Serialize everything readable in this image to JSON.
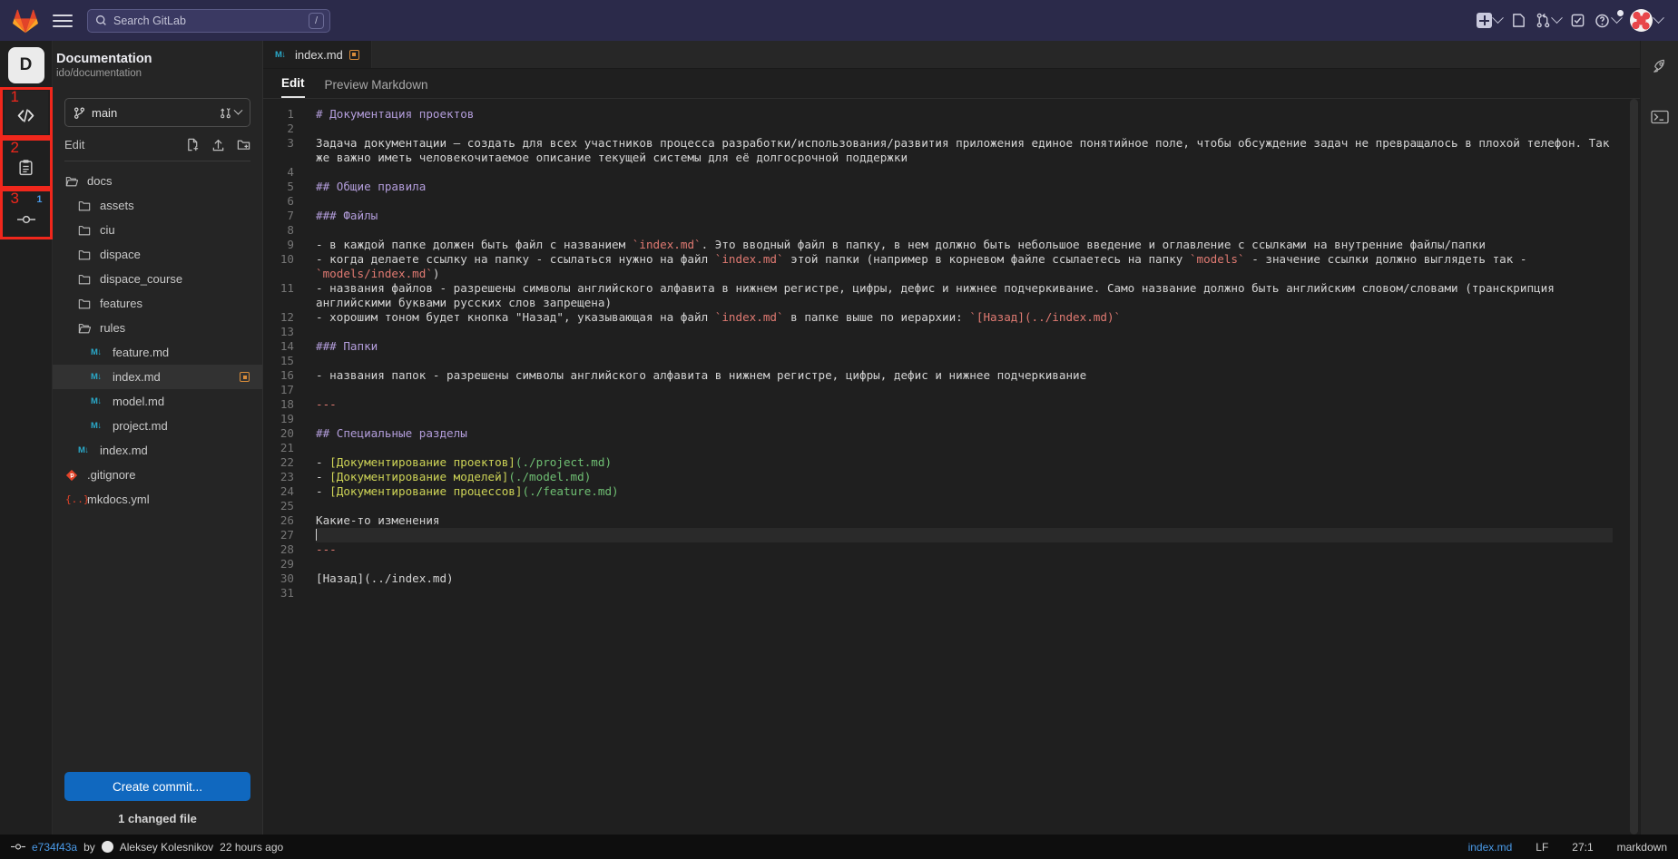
{
  "topnav": {
    "search_placeholder": "Search GitLab",
    "search_shortcut": "/",
    "icons": [
      "gitlab-logo",
      "hamburger-menu",
      "search-icon",
      "create-new-icon",
      "issues-icon",
      "merge-requests-icon",
      "todos-icon",
      "help-icon",
      "user-avatar"
    ]
  },
  "project": {
    "initial": "D",
    "name": "Documentation",
    "path": "ido/documentation"
  },
  "rail": {
    "items": [
      {
        "number": "1",
        "name": "edit-icon",
        "badge": ""
      },
      {
        "number": "2",
        "name": "review-icon",
        "badge": ""
      },
      {
        "number": "3",
        "name": "commit-icon",
        "badge": "1"
      }
    ]
  },
  "filepanel": {
    "branch": "main",
    "edit_label": "Edit",
    "actions": [
      "new-file-icon",
      "upload-file-icon",
      "new-directory-icon"
    ],
    "tree": [
      {
        "label": "docs",
        "type": "folder-open",
        "depth": 0,
        "modified": false,
        "selected": false
      },
      {
        "label": "assets",
        "type": "folder",
        "depth": 1,
        "modified": false,
        "selected": false
      },
      {
        "label": "ciu",
        "type": "folder",
        "depth": 1,
        "modified": false,
        "selected": false
      },
      {
        "label": "dispace",
        "type": "folder",
        "depth": 1,
        "modified": false,
        "selected": false
      },
      {
        "label": "dispace_course",
        "type": "folder",
        "depth": 1,
        "modified": false,
        "selected": false
      },
      {
        "label": "features",
        "type": "folder",
        "depth": 1,
        "modified": false,
        "selected": false
      },
      {
        "label": "rules",
        "type": "folder-open",
        "depth": 1,
        "modified": false,
        "selected": false
      },
      {
        "label": "feature.md",
        "type": "markdown",
        "depth": 2,
        "modified": false,
        "selected": false
      },
      {
        "label": "index.md",
        "type": "markdown",
        "depth": 2,
        "modified": true,
        "selected": true
      },
      {
        "label": "model.md",
        "type": "markdown",
        "depth": 2,
        "modified": false,
        "selected": false
      },
      {
        "label": "project.md",
        "type": "markdown",
        "depth": 2,
        "modified": false,
        "selected": false
      },
      {
        "label": "index.md",
        "type": "markdown",
        "depth": 1,
        "modified": false,
        "selected": false
      },
      {
        "label": ".gitignore",
        "type": "git",
        "depth": 0,
        "modified": false,
        "selected": false
      },
      {
        "label": "mkdocs.yml",
        "type": "yaml",
        "depth": 0,
        "modified": false,
        "selected": false
      }
    ],
    "commit_button": "Create commit...",
    "changed_files": "1 changed file"
  },
  "editor": {
    "tab": {
      "label": "index.md",
      "modified": true
    },
    "subtabs": [
      {
        "label": "Edit",
        "active": true
      },
      {
        "label": "Preview Markdown",
        "active": false
      }
    ],
    "lines": [
      {
        "n": 1,
        "parts": [
          {
            "t": "# Документация проектов",
            "c": "h"
          }
        ]
      },
      {
        "n": 2,
        "parts": []
      },
      {
        "n": 3,
        "parts": [
          {
            "t": "Задача документации — создать для всех участников процесса разработки/использования/развития приложения единое понятийное поле, чтобы обсуждение задач не превращалось в плохой телефон. Так же важно иметь человекочитаемое описание текущей системы для её долгосрочной поддержки",
            "c": ""
          }
        ]
      },
      {
        "n": 4,
        "parts": []
      },
      {
        "n": 5,
        "parts": [
          {
            "t": "## Общие правила",
            "c": "h"
          }
        ]
      },
      {
        "n": 6,
        "parts": []
      },
      {
        "n": 7,
        "parts": [
          {
            "t": "### Файлы",
            "c": "h"
          }
        ]
      },
      {
        "n": 8,
        "parts": []
      },
      {
        "n": 9,
        "parts": [
          {
            "t": "- в каждой папке должен быть файл с названием ",
            "c": ""
          },
          {
            "t": "`index.md`",
            "c": "c"
          },
          {
            "t": ". Это вводный файл в папку, в нем должно быть небольшое введение и оглавление с ссылками на внутренние файлы/папки",
            "c": ""
          }
        ]
      },
      {
        "n": 10,
        "parts": [
          {
            "t": "- когда делаете ссылку на папку - ссылаться нужно на файл ",
            "c": ""
          },
          {
            "t": "`index.md`",
            "c": "c"
          },
          {
            "t": " этой папки (например в корневом файле ссылаетесь на папку ",
            "c": ""
          },
          {
            "t": "`models`",
            "c": "c"
          },
          {
            "t": " - значение ссылки должно выглядеть так - ",
            "c": ""
          },
          {
            "t": "`models/index.md`",
            "c": "c"
          },
          {
            "t": ")",
            "c": ""
          }
        ]
      },
      {
        "n": 11,
        "parts": [
          {
            "t": "- названия файлов - разрешены символы английского алфавита в нижнем регистре, цифры, дефис и нижнее подчеркивание. Само название должно быть английским словом/словами (транскрипция английскими буквами русских слов запрещена)",
            "c": ""
          }
        ]
      },
      {
        "n": 12,
        "parts": [
          {
            "t": "- хорошим тоном будет кнопка \"Назад\", указывающая на файл ",
            "c": ""
          },
          {
            "t": "`index.md`",
            "c": "c"
          },
          {
            "t": " в папке выше по иерархии: ",
            "c": ""
          },
          {
            "t": "`[Назад](../index.md)`",
            "c": "c"
          }
        ]
      },
      {
        "n": 13,
        "parts": []
      },
      {
        "n": 14,
        "parts": [
          {
            "t": "### Папки",
            "c": "h"
          }
        ]
      },
      {
        "n": 15,
        "parts": []
      },
      {
        "n": 16,
        "parts": [
          {
            "t": "- названия папок - разрешены символы английского алфавита в нижнем регистре, цифры, дефис и нижнее подчеркивание",
            "c": ""
          }
        ]
      },
      {
        "n": 17,
        "parts": []
      },
      {
        "n": 18,
        "parts": [
          {
            "t": "---",
            "c": "hr"
          }
        ]
      },
      {
        "n": 19,
        "parts": []
      },
      {
        "n": 20,
        "parts": [
          {
            "t": "## Специальные разделы",
            "c": "h"
          }
        ]
      },
      {
        "n": 21,
        "parts": []
      },
      {
        "n": 22,
        "parts": [
          {
            "t": "- ",
            "c": ""
          },
          {
            "t": "[Документирование проектов]",
            "c": "lk"
          },
          {
            "t": "(./project.md)",
            "c": "ur"
          }
        ]
      },
      {
        "n": 23,
        "parts": [
          {
            "t": "- ",
            "c": ""
          },
          {
            "t": "[Документирование моделей]",
            "c": "lk"
          },
          {
            "t": "(./model.md)",
            "c": "ur"
          }
        ]
      },
      {
        "n": 24,
        "parts": [
          {
            "t": "- ",
            "c": ""
          },
          {
            "t": "[Документирование процессов]",
            "c": "lk"
          },
          {
            "t": "(./feature.md)",
            "c": "ur"
          }
        ]
      },
      {
        "n": 25,
        "parts": []
      },
      {
        "n": 26,
        "parts": [
          {
            "t": "Какие-то изменения",
            "c": ""
          }
        ]
      },
      {
        "n": 27,
        "parts": [],
        "cursor": true
      },
      {
        "n": 28,
        "parts": [
          {
            "t": "---",
            "c": "hr"
          }
        ]
      },
      {
        "n": 29,
        "parts": []
      },
      {
        "n": 30,
        "parts": [
          {
            "t": "[Назад](../index.md)",
            "c": ""
          }
        ]
      },
      {
        "n": 31,
        "parts": []
      }
    ]
  },
  "rightrail": {
    "items": [
      "rocket-icon",
      "terminal-icon"
    ]
  },
  "statusbar": {
    "sha": "e734f43a",
    "by": "by",
    "author": "Aleksey Kolesnikov",
    "time": "22 hours ago",
    "file": "index.md",
    "eol": "LF",
    "position": "27:1",
    "language": "markdown"
  },
  "colors": {
    "nav_bg": "#2b2a4a",
    "accent_blue": "#1068bf",
    "link_blue": "#4a9ae8",
    "annotation_red": "#f0271c",
    "modified_orange": "#d98c3a",
    "markdown_icon": "#2aa9c9"
  }
}
